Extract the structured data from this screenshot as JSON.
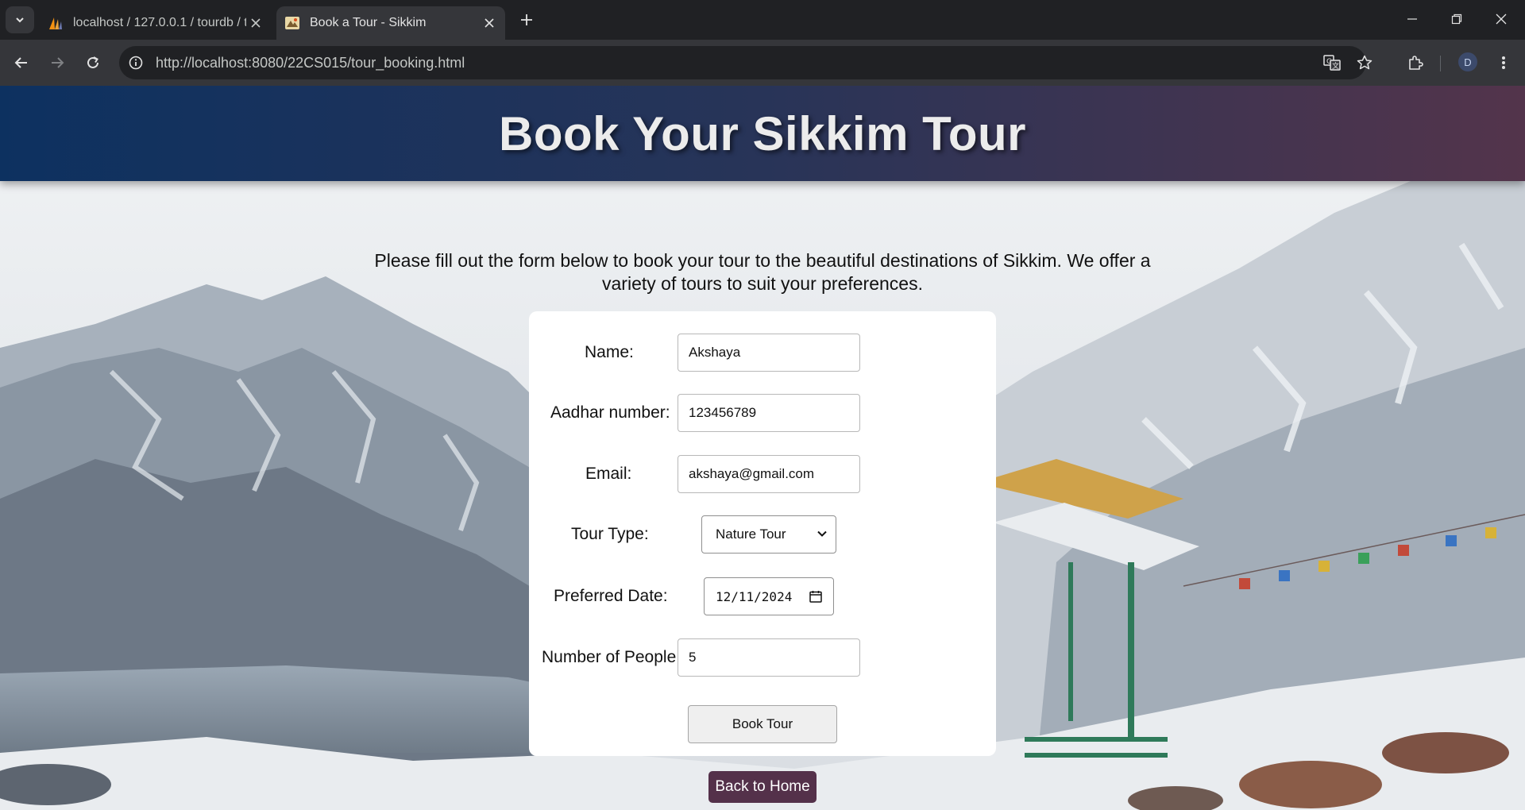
{
  "browser": {
    "tabs": [
      {
        "title": "localhost / 127.0.0.1 / tourdb / t",
        "active": false,
        "favicon": "phpmyadmin-sail-icon"
      },
      {
        "title": "Book a Tour - Sikkim",
        "active": true,
        "favicon": "tour-site-icon"
      }
    ],
    "url": "http://localhost:8080/22CS015/tour_booking.html",
    "profile_initial": "D"
  },
  "page": {
    "header_title": "Book Your Sikkim Tour",
    "intro": "Please fill out the form below to book your tour to the beautiful destinations of Sikkim. We offer a variety of tours to suit your preferences.",
    "form": {
      "name_label": "Name:",
      "name_value": "Akshaya",
      "aadhar_label": "Aadhar number:",
      "aadhar_value": "123456789",
      "email_label": "Email:",
      "email_value": "akshaya@gmail.com",
      "tour_type_label": "Tour Type:",
      "tour_type_value": "Nature Tour",
      "date_label": "Preferred Date:",
      "date_value": "12/11/2024",
      "people_label": "Number of People:",
      "people_value": "5",
      "submit_label": "Book Tour"
    },
    "back_home_label": "Back to Home"
  },
  "colors": {
    "header_gradient_start": "#0d3160",
    "header_gradient_end": "#53344b",
    "back_button": "#54314a"
  }
}
